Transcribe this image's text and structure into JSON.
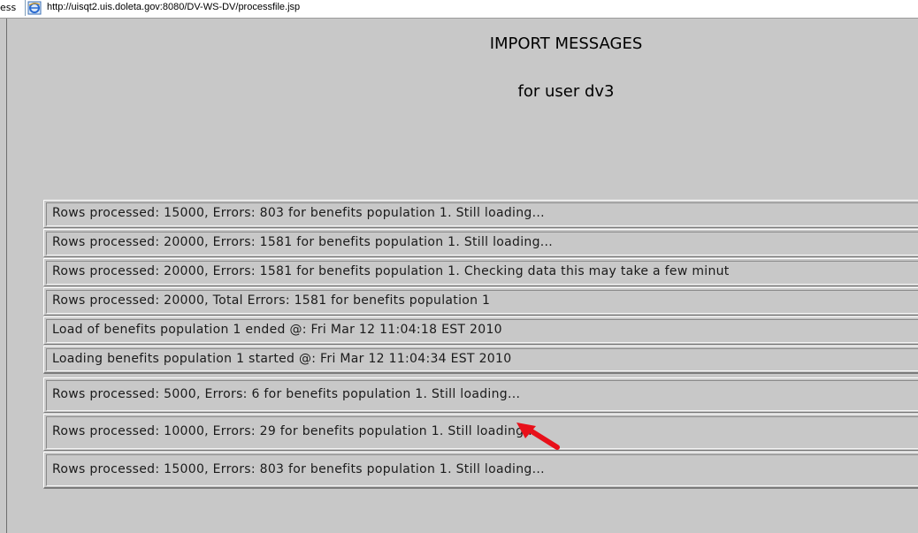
{
  "address_bar": {
    "label_fragment": "ess",
    "url": "http://uisqt2.uis.doleta.gov:8080/DV-WS-DV/processfile.jsp",
    "icon": "ie-page-icon"
  },
  "page": {
    "title": "IMPORT MESSAGES",
    "subtitle": "for user dv3"
  },
  "messages": [
    "Rows processed: 15000, Errors: 803 for benefits population 1. Still loading...",
    "Rows processed: 20000, Errors: 1581 for benefits population 1. Still loading...",
    "Rows processed: 20000, Errors: 1581 for benefits population 1. Checking data this may take a few minut",
    "Rows processed: 20000, Total Errors: 1581 for benefits population 1",
    "Load of benefits population 1 ended @: Fri Mar 12 11:04:18 EST 2010",
    "Loading benefits population 1 started @: Fri Mar 12 11:04:34 EST 2010",
    "Rows processed: 5000, Errors: 6 for benefits population 1. Still loading...",
    "Rows processed: 10000, Errors: 29 for benefits population 1. Still loading...",
    "Rows processed: 15000, Errors: 803 for benefits population 1. Still loading..."
  ],
  "annotation": {
    "icon": "red-arrow-icon",
    "color": "#e8101a"
  },
  "colors": {
    "page_background": "#c8c8c8",
    "text": "#1a1a1a"
  }
}
